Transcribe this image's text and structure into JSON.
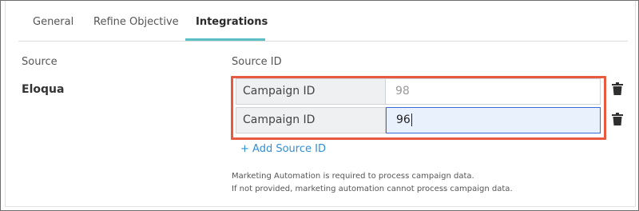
{
  "tabs": [
    {
      "label": "General"
    },
    {
      "label": "Refine Objective"
    },
    {
      "label": "Integrations"
    }
  ],
  "active_tab": "Integrations",
  "columns": {
    "source": "Source",
    "source_id": "Source ID"
  },
  "source": {
    "name": "Eloqua"
  },
  "source_ids": [
    {
      "label": "Campaign ID",
      "value": "98"
    },
    {
      "label": "Campaign ID",
      "value": "96"
    }
  ],
  "add_source_id_label": "+ Add Source ID",
  "help_text": {
    "line1": "Marketing Automation is required to process campaign data.",
    "line2": "If not provided, marketing automation cannot process campaign data."
  },
  "colors": {
    "accent_tab": "#5bbfc6",
    "highlight_border": "#e85a3f",
    "link": "#2f8fd8",
    "focused_input_border": "#3a6ad6"
  },
  "icons": {
    "delete": "trash-icon"
  }
}
